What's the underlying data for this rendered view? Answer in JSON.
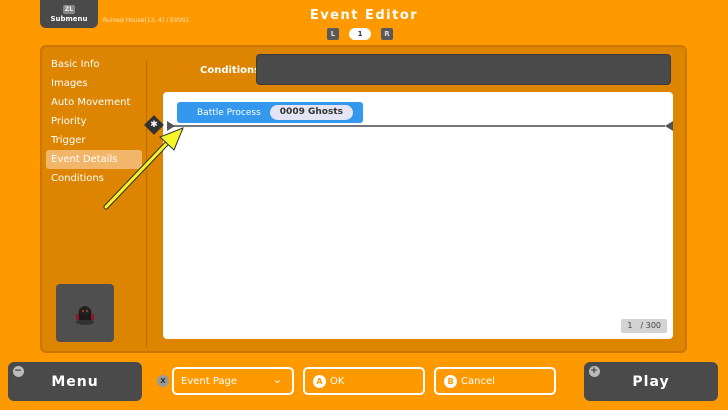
{
  "header": {
    "submenu_key": "ZL",
    "submenu_label": "Submenu",
    "map_location": "Ruined House(13, 4) / EV001",
    "title": "Event Editor",
    "prev_key": "L",
    "page": "1",
    "next_key": "R"
  },
  "sidebar": {
    "items": [
      {
        "label": "Basic Info"
      },
      {
        "label": "Images"
      },
      {
        "label": "Auto Movement"
      },
      {
        "label": "Priority"
      },
      {
        "label": "Trigger"
      },
      {
        "label": "Event Details"
      },
      {
        "label": "Conditions"
      }
    ],
    "active_index": 5
  },
  "conditions": {
    "label": "Conditions",
    "value": ""
  },
  "process": {
    "label": "Battle Process",
    "value": "0009 Ghosts"
  },
  "page_counter": {
    "current": "1",
    "total": "/ 300"
  },
  "footer": {
    "menu_label": "Menu",
    "menu_key": "−",
    "x_key": "X",
    "event_page_label": "Event Page",
    "ok_key": "A",
    "ok_label": "OK",
    "cancel_key": "B",
    "cancel_label": "Cancel",
    "play_key": "+",
    "play_label": "Play"
  },
  "colors": {
    "background": "#FF9900",
    "panel": "#DD8500",
    "process_block": "#3398EE",
    "annotation_arrow": "#F5F52A"
  },
  "icons": {
    "add_handle": "plus-diamond-icon",
    "dropdown": "chevron-down-icon",
    "character": "dark-character-sprite-icon"
  }
}
